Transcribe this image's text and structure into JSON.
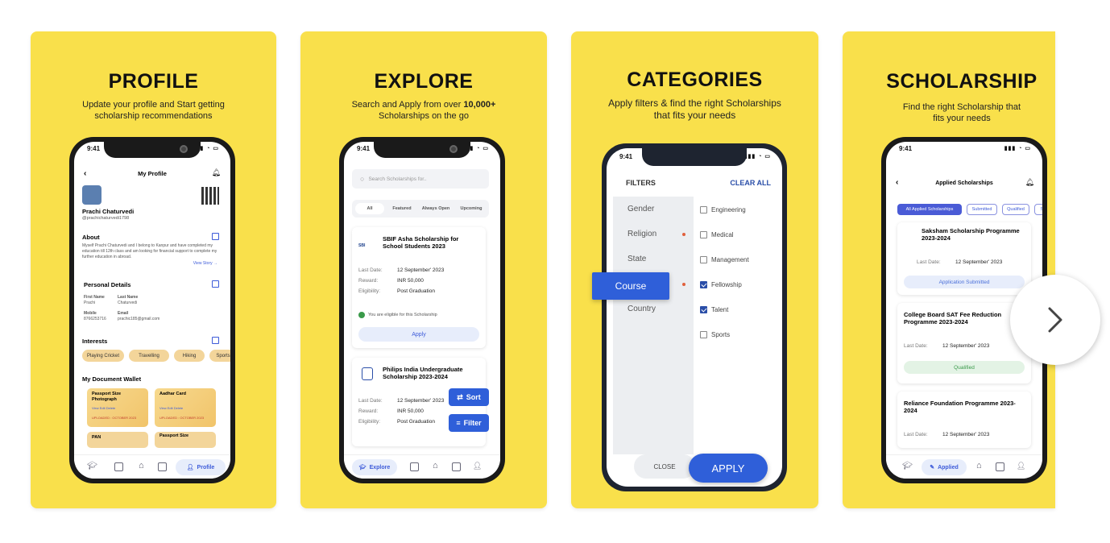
{
  "profile": {
    "title": "PROFILE",
    "subtitle_line1": "Update your profile and Start getting",
    "subtitle_line2": "scholarship recommendations",
    "time": "9:41",
    "screen_title": "My Profile",
    "user_name": "Prachi Chaturvedi",
    "user_handle": "@prachichaturvedi1798",
    "about_heading": "About",
    "about_text": "Myself Prachi Chaturvedi and I belong to Kanpur and have completed my education till 12th class and am looking for financial support to complete my further education in abroad.",
    "view_story": "View Story →",
    "personal_heading": "Personal Details",
    "first_name_label": "First Name",
    "first_name": "Prachi",
    "last_name_label": "Last Name",
    "last_name": "Chaturvedi",
    "mobile_label": "Mobile",
    "mobile": "8766253716",
    "email_label": "Email",
    "email": "prachic185@gmail.com",
    "interests_heading": "Interests",
    "interests": [
      "Playing Cricket",
      "Travelling",
      "Hiking",
      "Sports"
    ],
    "wallet_heading": "My Document Wallet",
    "doc1_title": "Passport Size Photograph",
    "doc1_actions": "View   Edit   Delete",
    "doc1_uploaded": "UPLOADED : OCTOBER 2023",
    "doc2_title": "Aadhar Card",
    "doc2_actions": "View   Edit   Delete",
    "doc2_uploaded": "UPLOADED : OCTOBER 2023",
    "doc3_title": "PAN",
    "doc4_title": "Passport Size",
    "nav_active": "Profile"
  },
  "explore": {
    "title": "EXPLORE",
    "subtitle_line1_a": "Search and Apply from over ",
    "subtitle_line1_b": "10,000+",
    "subtitle_line2": "Scholarships on the go",
    "time": "9:41",
    "search_placeholder": "Search Scholarships for..",
    "tabs": [
      "All",
      "Featured",
      "Always Open",
      "Upcoming"
    ],
    "card1_logo": "SBI",
    "card1_title": "SBIF Asha Scholarship for School Students 2023",
    "last_date_label": "Last Date:",
    "reward_label": "Reward:",
    "eligibility_label": "Eligibility:",
    "card1_last_date": "12 September' 2023",
    "card1_reward": "INR 50,000",
    "card1_eligibility": "Post Graduation",
    "eligible_note": "You are eligible for this Scholarship",
    "apply": "Apply",
    "card2_title": "Philips India Undergraduate Scholarship 2023-2024",
    "card2_last_date": "12 September' 2023",
    "card2_reward": "INR 50,000",
    "card2_eligibility": "Post Graduation",
    "sort": "Sort",
    "filter": "Filter",
    "nav_active": "Explore"
  },
  "categories": {
    "title": "CATEGORIES",
    "subtitle_line1": "Apply filters & find the right Scholarships",
    "subtitle_line2": "that fits your needs",
    "time": "9:41",
    "filters_heading": "FILTERS",
    "clear_all": "CLEAR ALL",
    "left_items": [
      "Gender",
      "Religion",
      "State",
      "Course",
      "Country"
    ],
    "options": [
      {
        "label": "Engineering",
        "checked": false
      },
      {
        "label": "Medical",
        "checked": false
      },
      {
        "label": "Management",
        "checked": false
      },
      {
        "label": "Fellowship",
        "checked": true
      },
      {
        "label": "Talent",
        "checked": true
      },
      {
        "label": "Sports",
        "checked": false
      }
    ],
    "close": "CLOSE",
    "apply": "APPLY"
  },
  "scholarship": {
    "title": "SCHOLARSHIP",
    "subtitle_line1": "Find the right Scholarship that",
    "subtitle_line2": "fits your needs",
    "time": "9:41",
    "screen_title": "Applied Scholarships",
    "filters": [
      "All Applied Scholarships",
      "Submitted",
      "Qualified",
      "Si"
    ],
    "c1_title": "Saksham Scholarship Programme 2023-2024",
    "last_date_label": "Last Date:",
    "c1_date": "12 September' 2023",
    "c1_status": "Application Submitted",
    "c2_title": "College Board SAT Fee Reduction Programme 2023-2024",
    "c2_date": "12 September' 2023",
    "c2_status": "Qualified",
    "c3_title": "Reliance Foundation Programme 2023-2024",
    "c3_date": "12 September' 2023",
    "nav_active": "Applied"
  },
  "next_arrow": "chevron-right-icon",
  "colors": {
    "card_bg": "#f9e04b",
    "accent_blue": "#2f5fd9",
    "status_green": "#3a9a4a"
  }
}
